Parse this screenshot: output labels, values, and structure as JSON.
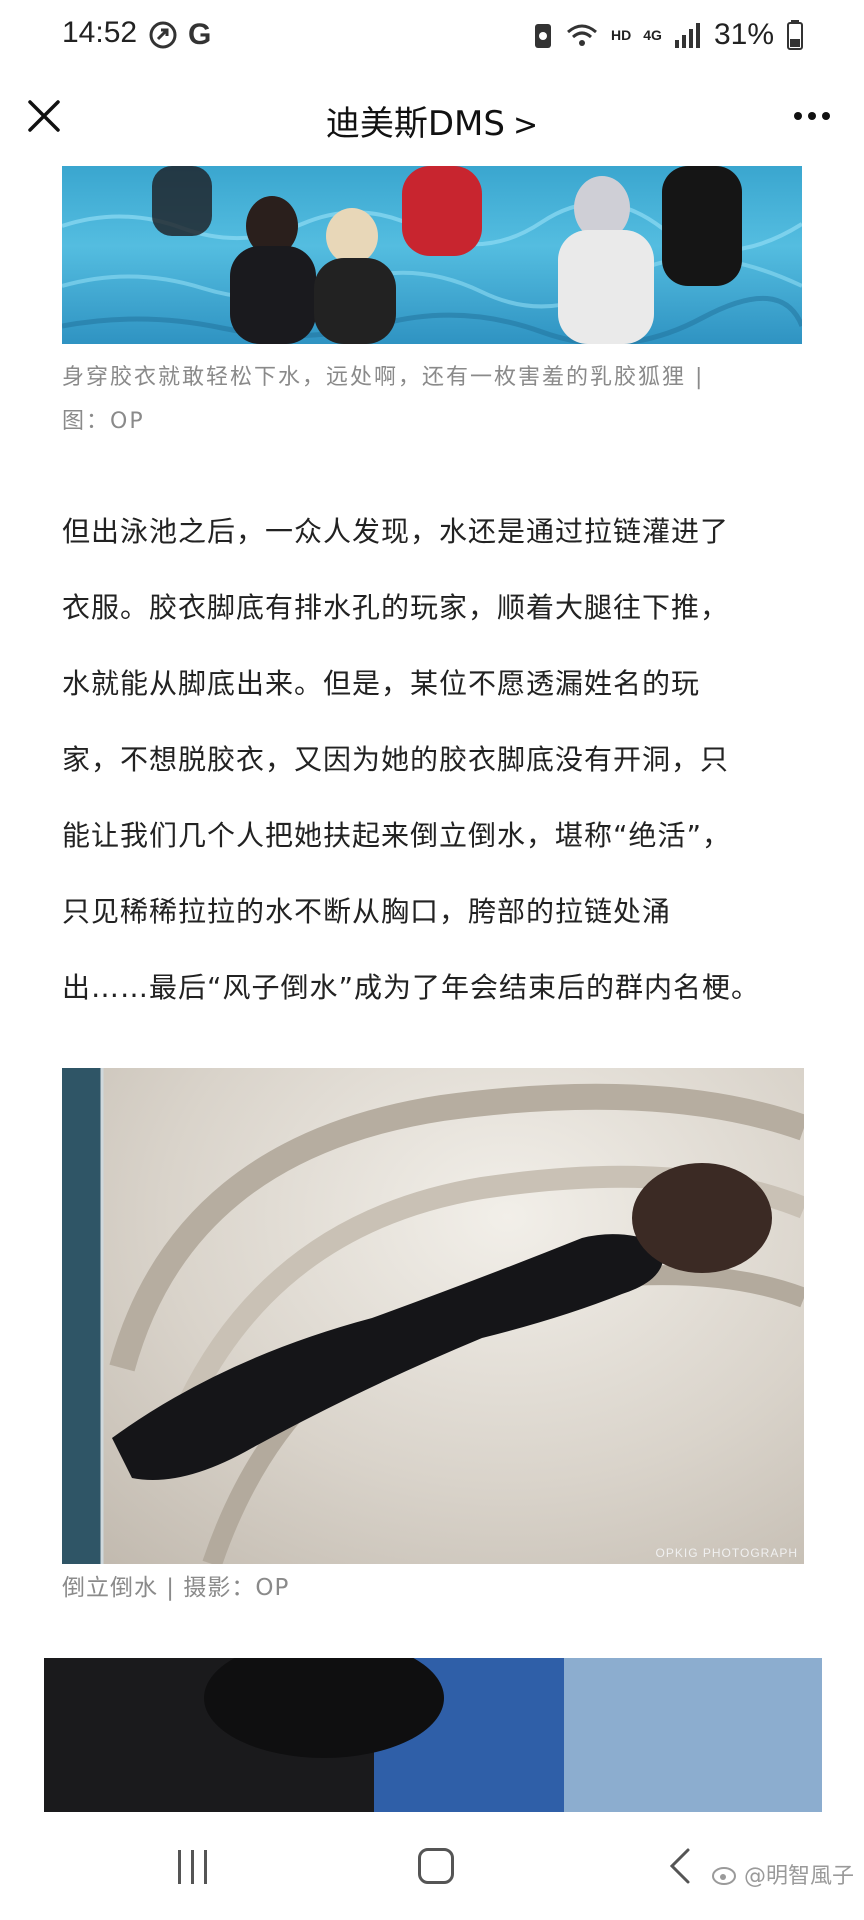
{
  "status_bar": {
    "time": "14:52",
    "left_icons": [
      "status-app-icon",
      "google-icon"
    ],
    "google_letter": "G",
    "hd_label": "HD",
    "network_label": "4G",
    "battery_percent": "31%"
  },
  "header": {
    "title": "迪美斯DMS",
    "chevron": ">",
    "close_icon": "close-icon",
    "more_icon": "more-icon"
  },
  "article": {
    "caption1_lines": [
      "身穿胶衣就敢轻松下水，远处啊，还有一枚害羞的乳胶狐狸 |",
      "图：OP"
    ],
    "paragraph_lines": [
      " 但出泳池之后，一众人发现，水还是通过拉链灌进了",
      "衣服。胶衣脚底有排水孔的玩家，顺着大腿往下推，",
      "水就能从脚底出来。但是，某位不愿透漏姓名的玩",
      "家，不想脱胶衣，又因为她的胶衣脚底没有开洞，只",
      "能让我们几个人把她扶起来倒立倒水，堪称“绝活”，",
      "只见稀稀拉拉的水不断从胸口，胯部的拉链处涌",
      "出……最后“风子倒水”成为了年会结束后的群内名梗。"
    ],
    "photo_watermark": "OPKIG PHOTOGRAPH",
    "caption2": "倒立倒水 | 摄影：OP"
  },
  "nav": {
    "recent_icon": "recent-apps-icon",
    "home_icon": "home-icon",
    "back_icon": "back-icon",
    "watermark": "@明智風子"
  },
  "colors": {
    "caption": "#8a8a8a",
    "text": "#222222",
    "pool_water": "#3aa6cf"
  }
}
